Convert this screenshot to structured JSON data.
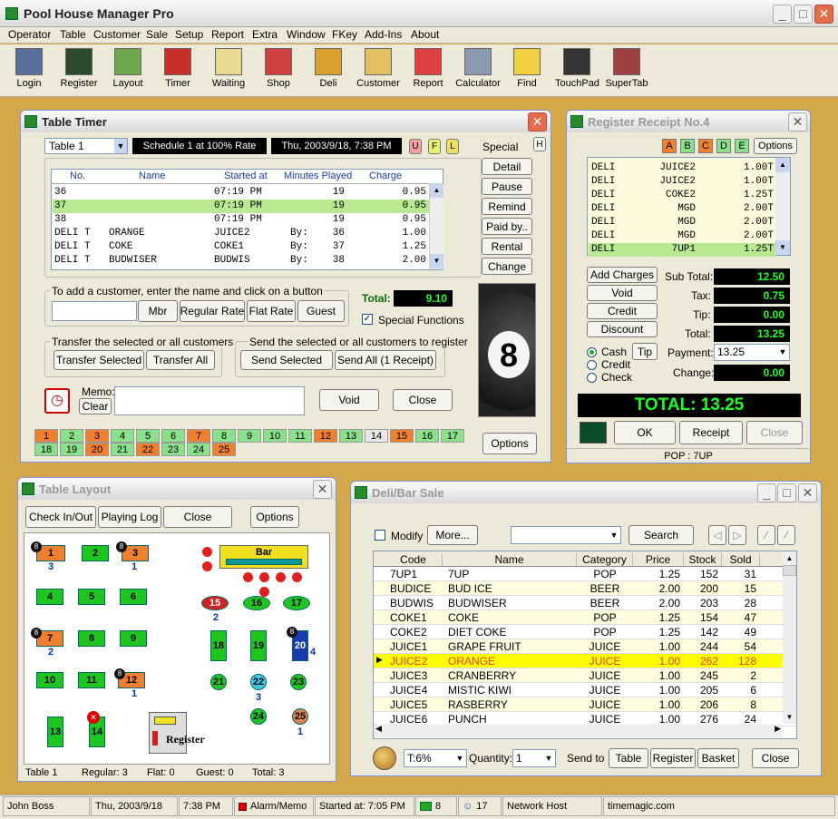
{
  "app": {
    "title": "Pool House Manager Pro"
  },
  "menu": [
    "Operator",
    "Table",
    "Customer",
    "Sale",
    "Setup",
    "Report",
    "Extra",
    "Window",
    "FKey",
    "Add-Ins",
    "About"
  ],
  "toolbar": [
    {
      "label": "Login",
      "icon": "login-icon",
      "color": "#5b6f9c"
    },
    {
      "label": "Register",
      "icon": "register-icon",
      "color": "#2c4a2c"
    },
    {
      "label": "Layout",
      "icon": "layout-icon",
      "color": "#6fa84f"
    },
    {
      "label": "Timer",
      "icon": "timer-icon",
      "color": "#c9302c"
    },
    {
      "label": "Waiting",
      "icon": "waiting-icon",
      "color": "#e8d890"
    },
    {
      "label": "Shop",
      "icon": "shop-icon",
      "color": "#d04040"
    },
    {
      "label": "Deli",
      "icon": "deli-icon",
      "color": "#d8a030"
    },
    {
      "label": "Customer",
      "icon": "customer-icon",
      "color": "#e0c060"
    },
    {
      "label": "Report",
      "icon": "report-icon",
      "color": "#e04040"
    },
    {
      "label": "Calculator",
      "icon": "calculator-icon",
      "color": "#8a9ab0"
    },
    {
      "label": "Find",
      "icon": "find-icon",
      "color": "#f0d040"
    },
    {
      "label": "TouchPad",
      "icon": "touchpad-icon",
      "color": "#333333"
    },
    {
      "label": "SuperTab",
      "icon": "supertab-icon",
      "color": "#a04040"
    }
  ],
  "timer": {
    "title": "Table Timer",
    "table_select": "Table  1",
    "schedule": "Schedule 1 at 100% Rate",
    "datetime": "Thu, 2003/9/18, 7:38 PM",
    "flags": [
      "U",
      "F",
      "L"
    ],
    "special_label": "Special",
    "h_btn": "H",
    "columns": [
      "No.",
      "Name",
      "Started at",
      "Minutes Played",
      "Charge"
    ],
    "rows": [
      [
        "36",
        "",
        "07:19 PM",
        "",
        "19",
        "0.95"
      ],
      [
        "37",
        "",
        "07:19 PM",
        "",
        "19",
        "0.95"
      ],
      [
        "38",
        "",
        "07:19 PM",
        "",
        "19",
        "0.95"
      ],
      [
        "DELI T",
        "ORANGE",
        "JUICE2",
        "By:",
        "36",
        "1.00"
      ],
      [
        "DELI T",
        "COKE",
        "COKE1",
        "By:",
        "37",
        "1.25"
      ],
      [
        "DELI T",
        "BUDWISER",
        "BUDWIS",
        "By:",
        "38",
        "2.00"
      ]
    ],
    "side_buttons": [
      "Detail",
      "Pause",
      "Remind",
      "Paid by..",
      "Rental",
      "Change"
    ],
    "add_customer_label": "To add a customer, enter the name and click on a button",
    "add_buttons": [
      "Mbr",
      "Regular Rate",
      "Flat Rate",
      "Guest"
    ],
    "total_label": "Total:",
    "total": "9.10",
    "special_functions": "Special Functions",
    "transfer_label": "Transfer the selected or all customers",
    "transfer_buttons": [
      "Transfer Selected",
      "Transfer All"
    ],
    "send_label": "Send the selected or all customers to register",
    "send_buttons": [
      "Send  Selected",
      "Send All (1 Receipt)"
    ],
    "memo_label": "Memo:",
    "clear": "Clear",
    "void": "Void",
    "close": "Close",
    "options": "Options",
    "tables_row1": [
      "1",
      "2",
      "3",
      "4",
      "5",
      "6",
      "7",
      "8",
      "9",
      "10",
      "11",
      "12",
      "13",
      "14",
      "15",
      "16",
      "17"
    ],
    "tables_row2": [
      "18",
      "19",
      "20",
      "21",
      "22",
      "23",
      "24",
      "25"
    ],
    "orange_tables": [
      "1",
      "3",
      "7",
      "12",
      "15",
      "20",
      "22",
      "25"
    ],
    "grey_tables": [
      "14"
    ],
    "ball": "8"
  },
  "receipt": {
    "title": "Register Receipt No.4",
    "tabs": [
      "A",
      "B",
      "C",
      "D",
      "E"
    ],
    "options": "Options",
    "lines": [
      [
        "DELI",
        "JUICE2",
        "1.00T"
      ],
      [
        "DELI",
        "JUICE2",
        "1.00T"
      ],
      [
        "DELI",
        "COKE2",
        "1.25T"
      ],
      [
        "DELI",
        "MGD",
        "2.00T"
      ],
      [
        "DELI",
        "MGD",
        "2.00T"
      ],
      [
        "DELI",
        "MGD",
        "2.00T"
      ],
      [
        "DELI",
        "7UP1",
        "1.25T"
      ]
    ],
    "actions": [
      "Add Charges",
      "Void",
      "Credit",
      "Discount"
    ],
    "subtotal_label": "Sub Total:",
    "subtotal": "12.50",
    "tax_label": "Tax:",
    "tax": "0.75",
    "tip_label": "Tip:",
    "tip": "0.00",
    "total_label": "Total:",
    "total": "13.25",
    "payment_types": [
      "Cash",
      "Credit",
      "Check"
    ],
    "tip_btn": "Tip",
    "payment_label": "Payment:",
    "payment": "13.25",
    "change_label": "Change:",
    "change": "0.00",
    "grand_total": "TOTAL: 13.25",
    "ok": "OK",
    "receipt_btn": "Receipt",
    "close": "Close",
    "footer": "POP   : 7UP"
  },
  "layout": {
    "title": "Table Layout",
    "buttons": [
      "Check In/Out",
      "Playing Log",
      "Close",
      "Options"
    ],
    "bar": "Bar",
    "register": "Register",
    "status": [
      "Table 1",
      "Regular: 3",
      "Flat: 0",
      "Guest: 0",
      "Total: 3"
    ],
    "tables": {
      "t1": "1",
      "t2": "2",
      "t3": "3",
      "t4": "4",
      "t5": "5",
      "t6": "6",
      "t7": "7",
      "t8": "8",
      "t9": "9",
      "t10": "10",
      "t11": "11",
      "t12": "12",
      "t13": "13",
      "t14": "14",
      "t15": "15",
      "t16": "16",
      "t17": "17",
      "t18": "18",
      "t19": "19",
      "t20": "20",
      "t21": "21",
      "t22": "22",
      "t23": "23",
      "t24": "24",
      "t25": "25"
    },
    "counts": {
      "c1": "3",
      "c3": "1",
      "c7": "2",
      "c12": "1",
      "c15": "2",
      "c20": "4",
      "c22": "3",
      "c25": "1"
    }
  },
  "deli": {
    "title": "Deli/Bar Sale",
    "modify": "Modify",
    "more": "More...",
    "search": "Search",
    "columns": [
      "Code",
      "Name",
      "Category",
      "Price",
      "Stock",
      "Sold"
    ],
    "rows": [
      [
        "7UP1",
        "7UP",
        "POP",
        "1.25",
        "152",
        "31"
      ],
      [
        "BUDICE",
        "BUD ICE",
        "BEER",
        "2.00",
        "200",
        "15"
      ],
      [
        "BUDWIS",
        "BUDWISER",
        "BEER",
        "2.00",
        "203",
        "28"
      ],
      [
        "COKE1",
        "COKE",
        "POP",
        "1.25",
        "154",
        "47"
      ],
      [
        "COKE2",
        "DIET COKE",
        "POP",
        "1.25",
        "142",
        "49"
      ],
      [
        "JUICE1",
        "GRAPE FRUIT",
        "JUICE",
        "1.00",
        "244",
        "54"
      ],
      [
        "JUICE2",
        "ORANGE",
        "JUICE",
        "1.00",
        "262",
        "128"
      ],
      [
        "JUICE3",
        "CRANBERRY",
        "JUICE",
        "1.00",
        "245",
        "2"
      ],
      [
        "JUICE4",
        "MISTIC KIWI",
        "JUICE",
        "1.00",
        "205",
        "6"
      ],
      [
        "JUICE5",
        "RASBERRY",
        "JUICE",
        "1.00",
        "206",
        "8"
      ],
      [
        "JUICE6",
        "PUNCH",
        "JUICE",
        "1.00",
        "276",
        "24"
      ]
    ],
    "tax": "T:6%",
    "quantity_label": "Quantity:",
    "quantity": "1",
    "send_to": "Send to",
    "send_buttons": [
      "Table",
      "Register",
      "Basket"
    ],
    "close": "Close"
  },
  "statusbar": [
    "John Boss",
    "Thu, 2003/9/18",
    "7:38 PM",
    "Alarm/Memo",
    "Started at: 7:05 PM",
    "8",
    "17",
    "Network Host",
    "timemagic.com"
  ]
}
